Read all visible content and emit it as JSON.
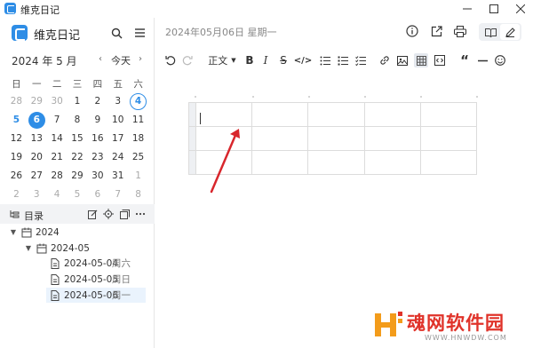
{
  "window": {
    "title": "维克日记"
  },
  "sidebar": {
    "app_name": "维克日记",
    "calendar": {
      "month_title": "2024 年 5 月",
      "prev": "‹",
      "today_label": "今天",
      "next": "›",
      "weekdays": [
        "日",
        "一",
        "二",
        "三",
        "四",
        "五",
        "六"
      ],
      "days": [
        [
          "28",
          "29",
          "30",
          "1",
          "2",
          "3",
          "4"
        ],
        [
          "5",
          "6",
          "7",
          "8",
          "9",
          "10",
          "11"
        ],
        [
          "12",
          "13",
          "14",
          "15",
          "16",
          "17",
          "18"
        ],
        [
          "19",
          "20",
          "21",
          "22",
          "23",
          "24",
          "25"
        ],
        [
          "26",
          "27",
          "28",
          "29",
          "30",
          "31",
          "1"
        ],
        [
          "2",
          "3",
          "4",
          "5",
          "6",
          "7",
          "8"
        ]
      ],
      "selected_day": "6",
      "today_day": "4"
    },
    "directory": {
      "label": "目录",
      "tree": [
        {
          "label": "2024"
        },
        {
          "label": "2024-05"
        },
        {
          "label": "2024-05-04",
          "weekday": "周六"
        },
        {
          "label": "2024-05-05",
          "weekday": "周日"
        },
        {
          "label": "2024-05-06",
          "weekday": "周一"
        }
      ]
    }
  },
  "main": {
    "date_header": "2024年05月06日 星期一",
    "toolbar": {
      "heading_style": "正文"
    }
  },
  "watermark": {
    "text": "魂网软件园",
    "url": "WWW.HNWDW.COM"
  },
  "colors": {
    "accent": "#2e8de6",
    "watermark_red": "#e0332a",
    "active_row_bg": "#eaf3fd"
  }
}
